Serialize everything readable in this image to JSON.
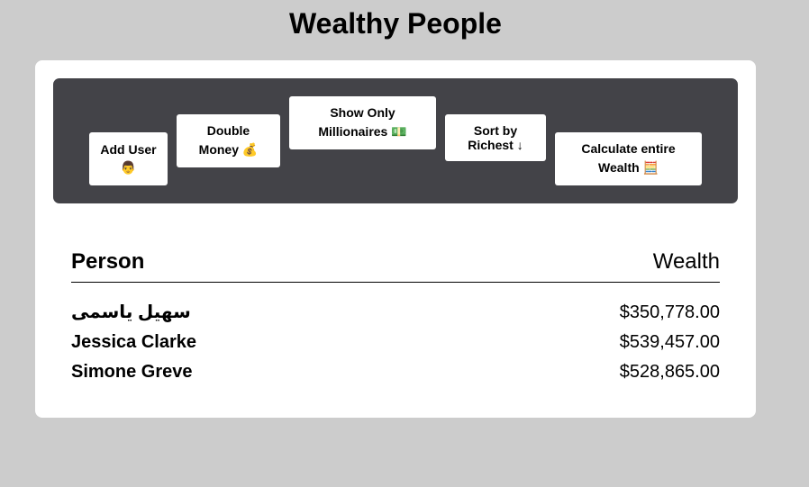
{
  "header": {
    "title": "Wealthy People"
  },
  "toolbar": {
    "buttons": [
      {
        "line1": "Add User",
        "emoji": "👨"
      },
      {
        "line1": "Double",
        "line2": "Money",
        "emoji": "💰"
      },
      {
        "line1": "Show Only",
        "line2": "Millionaires",
        "emoji": "💵"
      },
      {
        "line1": "Sort by",
        "line2": "Richest",
        "emoji": "↓"
      },
      {
        "line1": "Calculate entire",
        "line2": "Wealth",
        "emoji": "🧮"
      }
    ]
  },
  "table": {
    "columns": {
      "person": "Person",
      "wealth": "Wealth"
    },
    "rows": [
      {
        "name": "سهيل ياسمی",
        "wealth": "$350,778.00"
      },
      {
        "name": "Jessica Clarke",
        "wealth": "$539,457.00"
      },
      {
        "name": "Simone Greve",
        "wealth": "$528,865.00"
      }
    ]
  }
}
